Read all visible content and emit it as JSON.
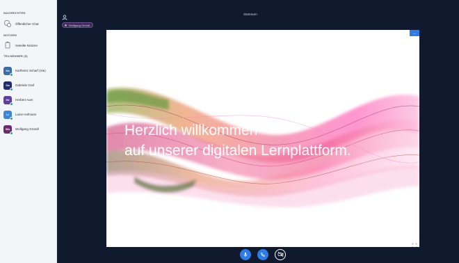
{
  "sidebar": {
    "messages_title": "NACHRICHTEN",
    "public_chat": "Öffentlicher Chat",
    "notes_title": "NOTIZEN",
    "shared_notes": "Geteilte Notizen",
    "participants_title": "TEILNEHMER (5)",
    "participants": [
      {
        "initials": "Ka",
        "name": "Karlheinz Scharf (Sie)",
        "color": "#3b6ea5"
      },
      {
        "initials": "Ga",
        "name": "Gabriele Graf",
        "color": "#1f2d6e"
      },
      {
        "initials": "He",
        "name": "Herbert Auer",
        "color": "#5c3f9e"
      },
      {
        "initials": "Li",
        "name": "Liane Hofmann",
        "color": "#3d86d6"
      },
      {
        "initials": "Wo",
        "name": "Wolfgang Gründl",
        "color": "#6b2c6e"
      }
    ]
  },
  "header": {
    "title": "Startraum",
    "speaker": "Wolfgang Gründl"
  },
  "presentation": {
    "line1": "Herzlich willkommen",
    "line2": "auf unserer digitalen Lernplattform.",
    "menu_button": "..."
  },
  "colors": {
    "accent": "#2f7be5",
    "background": "#0f1a2e",
    "status_green": "#2ca08e"
  },
  "icons": {
    "chat": "chat-icon",
    "notes": "notes-icon",
    "user": "user-icon",
    "mic": "microphone-icon",
    "phone": "phone-icon",
    "camera": "camera-icon",
    "fit": "fit-screen-icon"
  }
}
